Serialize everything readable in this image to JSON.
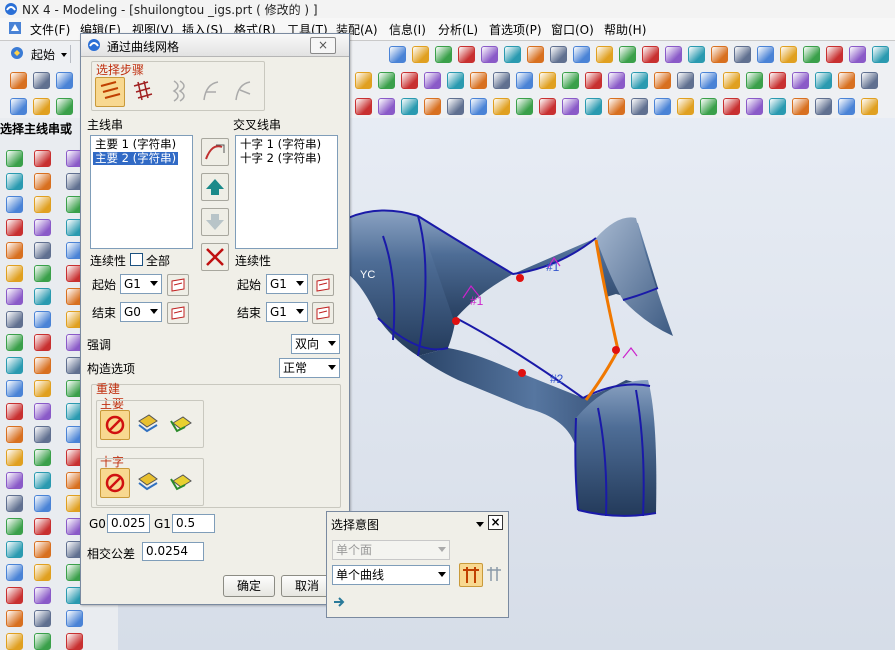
{
  "window": {
    "title": "NX 4 - Modeling - [shuilongtou _igs.prt ( 修改的 ) ]"
  },
  "menu": [
    "文件(F)",
    "编辑(E)",
    "视图(V)",
    "插入(S)",
    "格式(R)",
    "工具(T)",
    "装配(A)",
    "信息(I)",
    "分析(L)",
    "首选项(P)",
    "窗口(O)",
    "帮助(H)"
  ],
  "toolbar": {
    "start_label": "起始"
  },
  "left_panel": {
    "label": "选择主线串或"
  },
  "dialog": {
    "title": "通过曲线网格",
    "steps_label": "选择步骤",
    "primary_label": "主线串",
    "primary_items": [
      "主要 1 (字符串)",
      "主要 2 (字符串)"
    ],
    "primary_selected_index": 1,
    "cross_label": "交叉线串",
    "cross_items": [
      "十字 1 (字符串)",
      "十字 2 (字符串)"
    ],
    "continuity_label": "连续性",
    "all_label": "全部",
    "continuity_right_label": "连续性",
    "start_label": "起始",
    "end_label": "结束",
    "primary_start": "G1",
    "primary_end": "G0",
    "cross_start": "G1",
    "cross_end": "G1",
    "emphasis_label": "强调",
    "emphasis_value": "双向",
    "construction_label": "构造选项",
    "construction_value": "正常",
    "rebuild_label": "重建",
    "rebuild_primary_label": "主要",
    "rebuild_cross_label": "十字",
    "g0_label": "G0",
    "g0_value": "0.025",
    "g1_label": "G1",
    "g1_value": "0.5",
    "tolerance_label": "相交公差",
    "tolerance_value": "0.0254",
    "ok_label": "确定",
    "cancel_label": "取消"
  },
  "select_intent": {
    "title": "选择意图",
    "face_option": "单个面",
    "curve_option": "单个曲线"
  },
  "viewport": {
    "wcs_label": "YC",
    "labels": [
      "#1",
      "#1",
      "#2"
    ]
  },
  "colors": {
    "surface": "#3f5f85",
    "edge": "#1a1aa8",
    "highlight": "#f07800",
    "point": "#e01010",
    "selection": "#316ac5"
  }
}
